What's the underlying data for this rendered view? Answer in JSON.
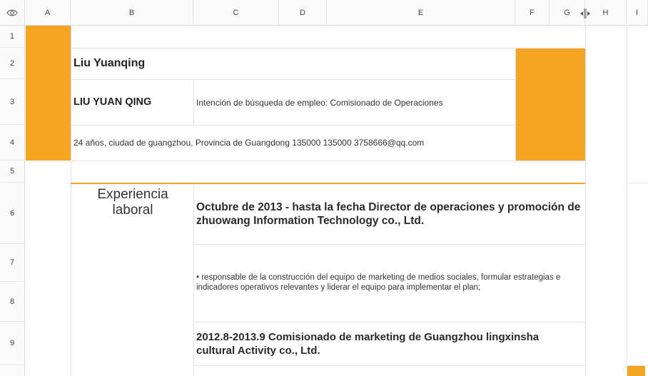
{
  "columns": [
    "A",
    "B",
    "C",
    "D",
    "E",
    "F",
    "G",
    "H",
    "I"
  ],
  "rows": [
    "1",
    "2",
    "3",
    "4",
    "5",
    "6",
    "7",
    "8",
    "9"
  ],
  "icons": {
    "corner": "eye-icon",
    "resize": "column-resize-icon"
  },
  "colors": {
    "accent": "#f4a523",
    "rule": "#f4a523"
  },
  "resume": {
    "name": "Liu Yuanqing",
    "name_caps": "LIU YUAN QING",
    "job_intent": "Intención de búsqueda de empleo: Comisionado de Operaciones",
    "contact": "24 años, ciudad de guangzhou, Provincia de Guangdong 135000 135000 3758666@qq.com",
    "section_title": "Experiencia laboral",
    "job1_title": "Octubre de 2013 - hasta la fecha Director de operaciones y promoción de zhuowang Information Technology co., Ltd.",
    "job1_desc": "• responsable de la construcción del equipo de marketing de medios sociales, formular estrategias e indicadores operativos relevantes y liderar el equipo para implementar el plan;",
    "job2_title": "2012.8-2013.9 Comisionado de marketing de Guangzhou lingxinsha cultural Activity co., Ltd."
  }
}
